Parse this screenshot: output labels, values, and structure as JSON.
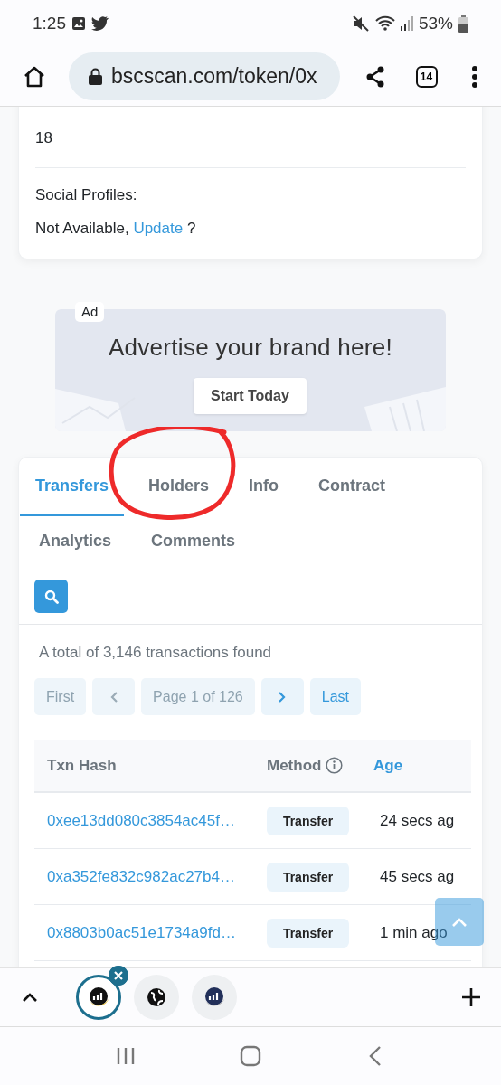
{
  "status_bar": {
    "time": "1:25",
    "battery": "53%"
  },
  "browser": {
    "url": "bscscan.com/token/0x",
    "tab_count": "14"
  },
  "token_info": {
    "fields": [
      {
        "kind": "plain",
        "value": "18"
      },
      {
        "kind": "link",
        "label": "Social Profiles:",
        "value": "Not Available,",
        "link": "Update",
        "suffix": "?"
      }
    ]
  },
  "ad": {
    "badge": "Ad",
    "headline": "Advertise your brand here!",
    "button": "Start Today"
  },
  "tabs": [
    {
      "label": "Transfers",
      "selected": true
    },
    {
      "label": "Holders",
      "selected": false
    },
    {
      "label": "Info",
      "selected": false
    },
    {
      "label": "Contract",
      "selected": false
    },
    {
      "label": "Analytics",
      "selected": false
    },
    {
      "label": "Comments",
      "selected": false
    }
  ],
  "summary": "A total of 3,146 transactions found",
  "pagination": [
    {
      "kind": "text",
      "label": "First",
      "disabled": true
    },
    {
      "kind": "prev",
      "disabled": true
    },
    {
      "kind": "text",
      "label": "Page 1 of 126",
      "disabled": true
    },
    {
      "kind": "next",
      "disabled": false
    },
    {
      "kind": "text",
      "label": "Last",
      "disabled": false
    }
  ],
  "table": {
    "columns": [
      {
        "label": "Txn Hash",
        "kind": "plain"
      },
      {
        "label": "Method",
        "kind": "info"
      },
      {
        "label": "Age",
        "kind": "link"
      }
    ],
    "rows": [
      {
        "hash": "0xee13dd080c3854ac45f…",
        "method": "Transfer",
        "age": "24 secs ag"
      },
      {
        "hash": "0xa352fe832c982ac27b4…",
        "method": "Transfer",
        "age": "45 secs ag"
      },
      {
        "hash": "0x8803b0ac51e1734a9fd…",
        "method": "Transfer",
        "age": "1 min ago"
      }
    ]
  },
  "open_tabs": [
    {
      "selected": true
    },
    {
      "selected": false
    },
    {
      "selected": false
    }
  ]
}
